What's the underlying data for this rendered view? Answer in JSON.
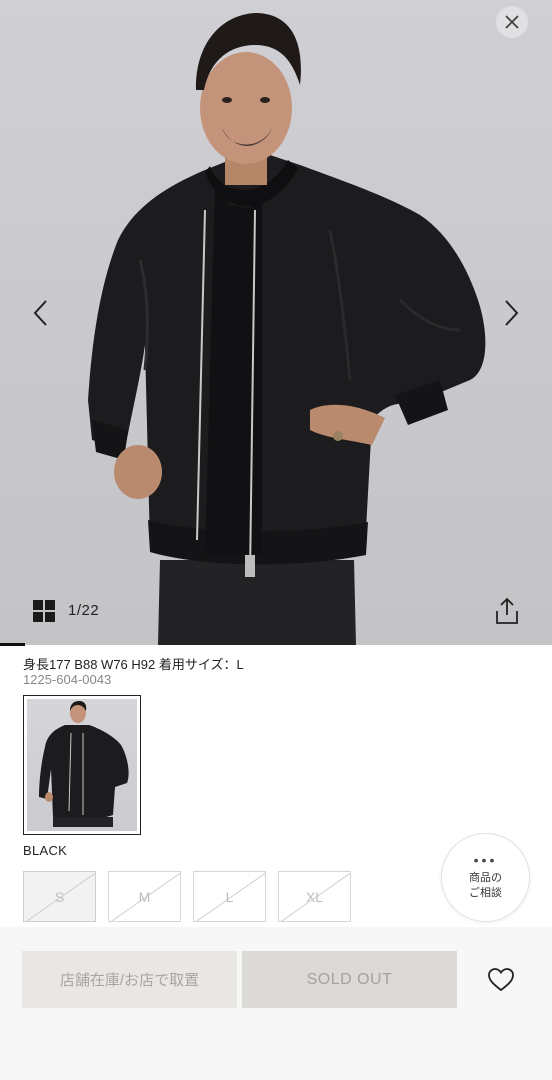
{
  "gallery": {
    "counter": "1/22",
    "close_icon": "close-icon",
    "prev_icon": "chevron-left-icon",
    "next_icon": "chevron-right-icon",
    "grid_icon": "grid-icon",
    "share_icon": "share-icon",
    "progress_fraction": 0.045
  },
  "product": {
    "model_info": "身長177 B88 W76 H92 着用サイズ：L",
    "item_code": "1225-604-0043",
    "color_name": "BLACK",
    "sizes": [
      {
        "label": "S",
        "selected": true,
        "available": false
      },
      {
        "label": "M",
        "selected": false,
        "available": false
      },
      {
        "label": "L",
        "selected": false,
        "available": false
      },
      {
        "label": "XL",
        "selected": false,
        "available": false
      }
    ]
  },
  "consult": {
    "dots": "•••",
    "label": "商品の\nご相談"
  },
  "actions": {
    "store_label": "店舗在庫/お店で取置",
    "soldout_label": "SOLD OUT",
    "favorite_icon": "heart-icon"
  },
  "colors": {
    "bg": "#ffffff",
    "bottom_bar": "#f7f7f7",
    "disabled_text": "#a9a6a2",
    "jacket": "#1c1c1e"
  }
}
